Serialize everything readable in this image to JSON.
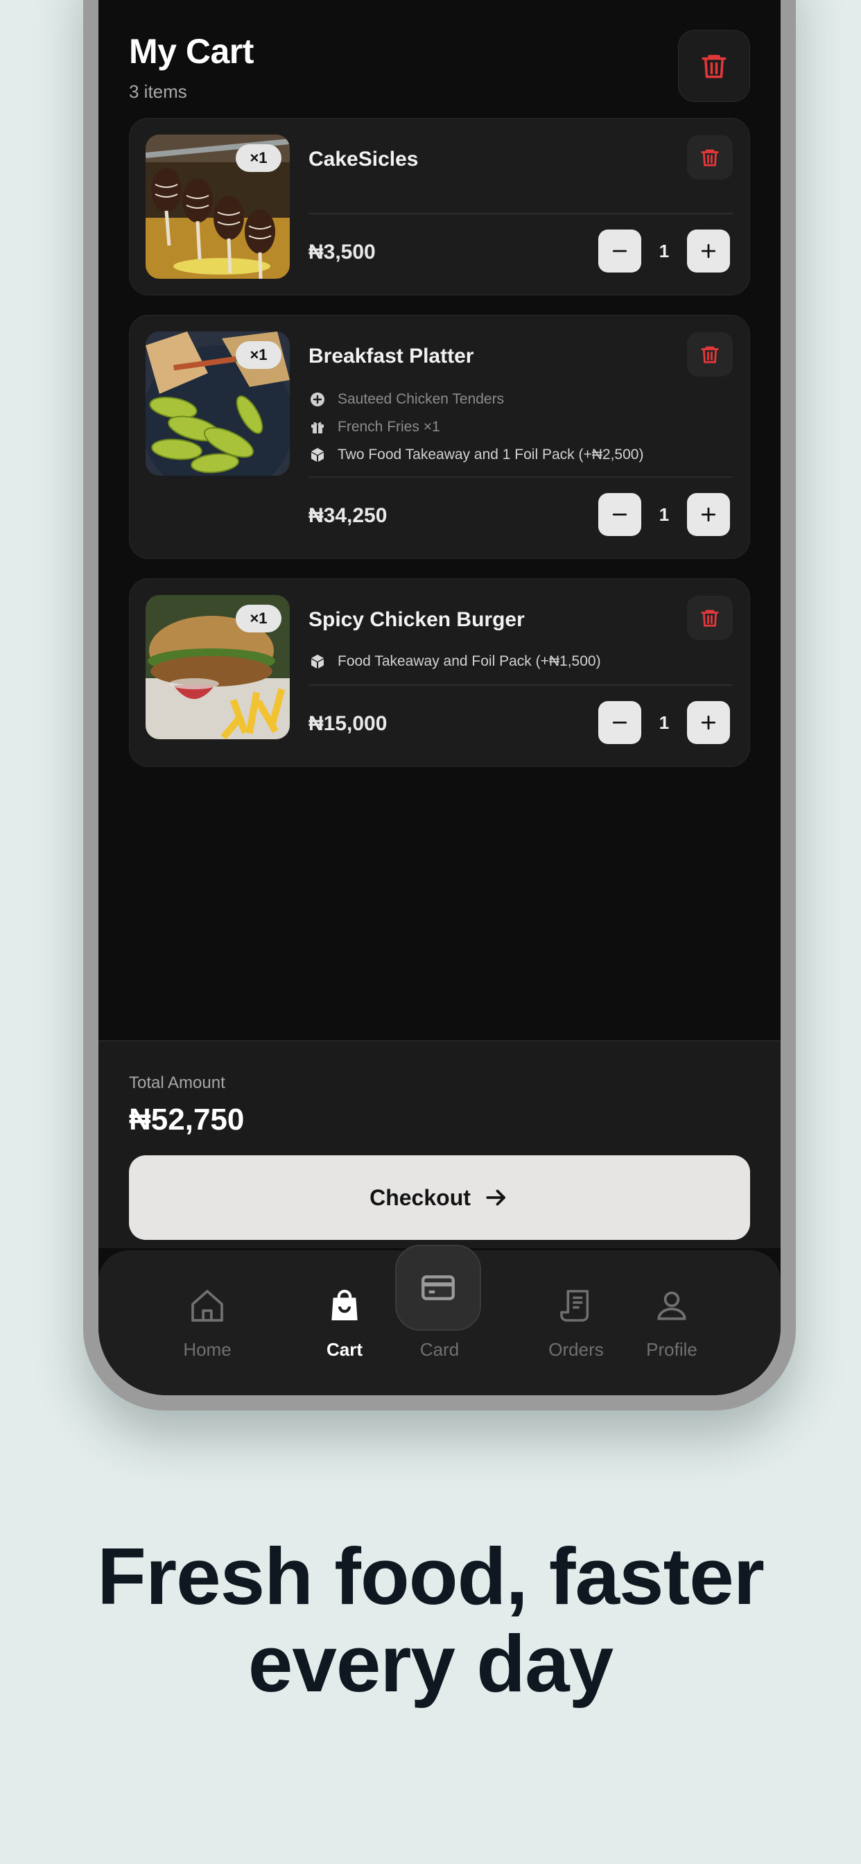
{
  "header": {
    "title": "My Cart",
    "subtitle": "3 items"
  },
  "currency_symbol": "₦",
  "items": [
    {
      "name": "CakeSicles",
      "qty_badge": "×1",
      "price": "₦3,500",
      "quantity": "1",
      "options": []
    },
    {
      "name": "Breakfast Platter",
      "qty_badge": "×1",
      "price": "₦34,250",
      "quantity": "1",
      "options": [
        {
          "icon": "plus-circle-icon",
          "text": "Sauteed Chicken Tenders"
        },
        {
          "icon": "gift-icon",
          "text": "French Fries ×1"
        },
        {
          "icon": "box-icon",
          "text": "Two Food Takeaway and 1 Foil Pack (+₦2,500)"
        }
      ]
    },
    {
      "name": "Spicy Chicken Burger",
      "qty_badge": "×1",
      "price": "₦15,000",
      "quantity": "1",
      "options": [
        {
          "icon": "box-icon",
          "text": "Food Takeaway and Foil Pack (+₦1,500)"
        }
      ]
    }
  ],
  "total": {
    "label": "Total Amount",
    "value": "₦52,750"
  },
  "checkout": {
    "label": "Checkout"
  },
  "tabs": [
    {
      "label": "Home",
      "icon": "home-icon",
      "active": false
    },
    {
      "label": "Cart",
      "icon": "shopping-bag-icon",
      "active": true
    },
    {
      "label": "Card",
      "icon": "credit-card-icon",
      "active": false
    },
    {
      "label": "Orders",
      "icon": "receipt-icon",
      "active": false
    },
    {
      "label": "Profile",
      "icon": "user-icon",
      "active": false
    }
  ],
  "tagline": {
    "line1": "Fresh food, faster",
    "line2": "every day"
  },
  "colors": {
    "accent_red": "#e5383b",
    "background": "#e3eceb",
    "screen": "#0d0d0d"
  }
}
